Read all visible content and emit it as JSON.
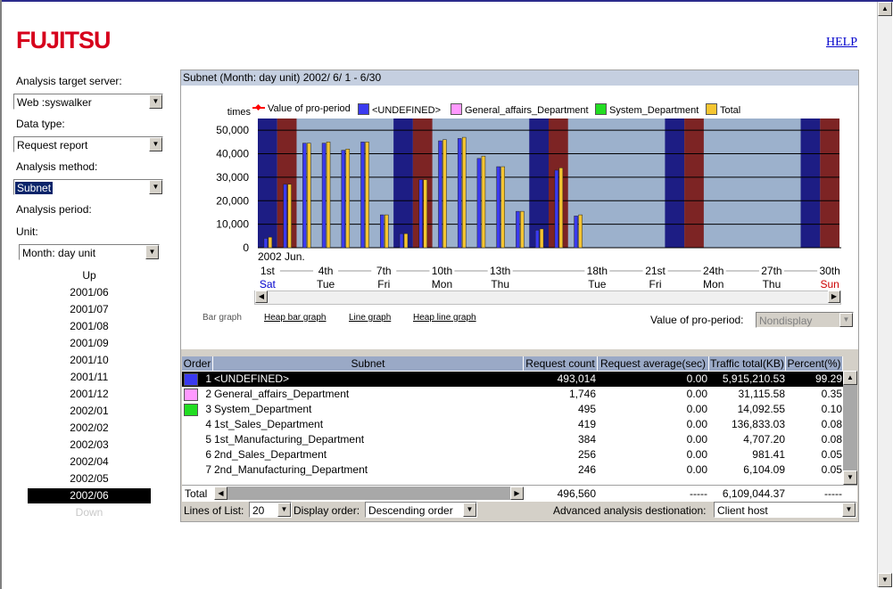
{
  "brand": {
    "logo": "FUJITSU",
    "help": "HELP"
  },
  "sidebar": {
    "server_label": "Analysis target server:",
    "server_value": "Web  :syswalker",
    "datatype_label": "Data type:",
    "datatype_value": "Request report",
    "method_label": "Analysis method:",
    "method_value": "Subnet",
    "period_label": "Analysis period:",
    "unit_label": "Unit:",
    "unit_value": "Month: day unit",
    "up": "Up",
    "down": "Down",
    "months": [
      "2001/06",
      "2001/07",
      "2001/08",
      "2001/09",
      "2001/10",
      "2001/11",
      "2001/12",
      "2002/01",
      "2002/02",
      "2002/03",
      "2002/04",
      "2002/05",
      "2002/06"
    ],
    "active_month": "2002/06"
  },
  "panel": {
    "title": "Subnet  (Month: day unit)  2002/ 6/ 1 -   6/30",
    "graph_tabs": [
      "Bar graph",
      "Heap bar graph",
      "Line graph",
      "Heap line graph"
    ],
    "pro_period_label": "Value of pro-period:",
    "pro_period_value": "Nondisplay"
  },
  "chart_data": {
    "type": "bar",
    "ylabel": "times",
    "ylim": [
      0,
      55000
    ],
    "yticks": [
      "50,000",
      "40,000",
      "30,000",
      "20,000",
      "10,000",
      "0"
    ],
    "month_label": "2002 Jun.",
    "x_tick_days": [
      "1st",
      "4th",
      "7th",
      "10th",
      "13th",
      "18th",
      "21st",
      "24th",
      "27th",
      "30th"
    ],
    "x_tick_weekdays": [
      "Sat",
      "Tue",
      "Fri",
      "Mon",
      "Thu",
      "Tue",
      "Fri",
      "Mon",
      "Thu",
      "Sun"
    ],
    "legend": [
      {
        "name": "Value of pro-period",
        "color": "#ff0000"
      },
      {
        "name": "<UNDEFINED>",
        "color": "#3a3af0"
      },
      {
        "name": "General_affairs_Department",
        "color": "#ff99ff"
      },
      {
        "name": "System_Department",
        "color": "#22dd22"
      },
      {
        "name": "Total",
        "color": "#f5c531"
      }
    ],
    "days": [
      1,
      2,
      3,
      4,
      5,
      6,
      7,
      8,
      9,
      10,
      11,
      12,
      13,
      14,
      15,
      16,
      17,
      18,
      19,
      20,
      21,
      22,
      23,
      24,
      25,
      26,
      27,
      28,
      29,
      30
    ],
    "weekend_days": [
      1,
      2,
      8,
      9,
      15,
      16,
      22,
      23,
      29,
      30
    ],
    "series": [
      {
        "name": "<UNDEFINED>",
        "values": [
          4000,
          27000,
          44500,
          44500,
          41500,
          45000,
          14000,
          6000,
          29000,
          45500,
          46500,
          38000,
          34500,
          15500,
          7500,
          33000,
          13500,
          0,
          0,
          0,
          0,
          0,
          0,
          0,
          0,
          0,
          0,
          0,
          0,
          0
        ]
      },
      {
        "name": "Total",
        "values": [
          4500,
          27000,
          44500,
          45000,
          42000,
          45000,
          14000,
          6000,
          29000,
          46000,
          47000,
          39000,
          34500,
          15500,
          8000,
          34000,
          14000,
          0,
          0,
          0,
          0,
          0,
          0,
          0,
          0,
          0,
          0,
          0,
          0,
          0
        ]
      }
    ]
  },
  "table": {
    "headers": [
      "Order",
      "Subnet",
      "Request count",
      "Request average(sec)",
      "Traffic total(KB)",
      "Percent(%)"
    ],
    "rows": [
      {
        "order": "1",
        "color": "#3a3af0",
        "subnet": "<UNDEFINED>",
        "count": "493,014",
        "avg": "0.00",
        "traffic": "5,915,210.53",
        "pct": "99.29"
      },
      {
        "order": "2",
        "color": "#ff99ff",
        "subnet": "General_affairs_Department",
        "count": "1,746",
        "avg": "0.00",
        "traffic": "31,115.58",
        "pct": "0.35"
      },
      {
        "order": "3",
        "color": "#22dd22",
        "subnet": "System_Department",
        "count": "495",
        "avg": "0.00",
        "traffic": "14,092.55",
        "pct": "0.10"
      },
      {
        "order": "4",
        "color": "",
        "subnet": "1st_Sales_Department",
        "count": "419",
        "avg": "0.00",
        "traffic": "136,833.03",
        "pct": "0.08"
      },
      {
        "order": "5",
        "color": "",
        "subnet": "1st_Manufacturing_Department",
        "count": "384",
        "avg": "0.00",
        "traffic": "4,707.20",
        "pct": "0.08"
      },
      {
        "order": "6",
        "color": "",
        "subnet": "2nd_Sales_Department",
        "count": "256",
        "avg": "0.00",
        "traffic": "981.41",
        "pct": "0.05"
      },
      {
        "order": "7",
        "color": "",
        "subnet": "2nd_Manufacturing_Department",
        "count": "246",
        "avg": "0.00",
        "traffic": "6,104.09",
        "pct": "0.05"
      }
    ],
    "total_label": "Total",
    "total_count": "496,560",
    "total_avg": "-----",
    "total_traffic": "6,109,044.37",
    "total_pct": "-----"
  },
  "footer": {
    "lines_label": "Lines of List:",
    "lines_value": "20",
    "order_label": "Display order:",
    "order_value": "Descending order",
    "adv_label": "Advanced analysis destionation:",
    "adv_value": "Client host"
  }
}
